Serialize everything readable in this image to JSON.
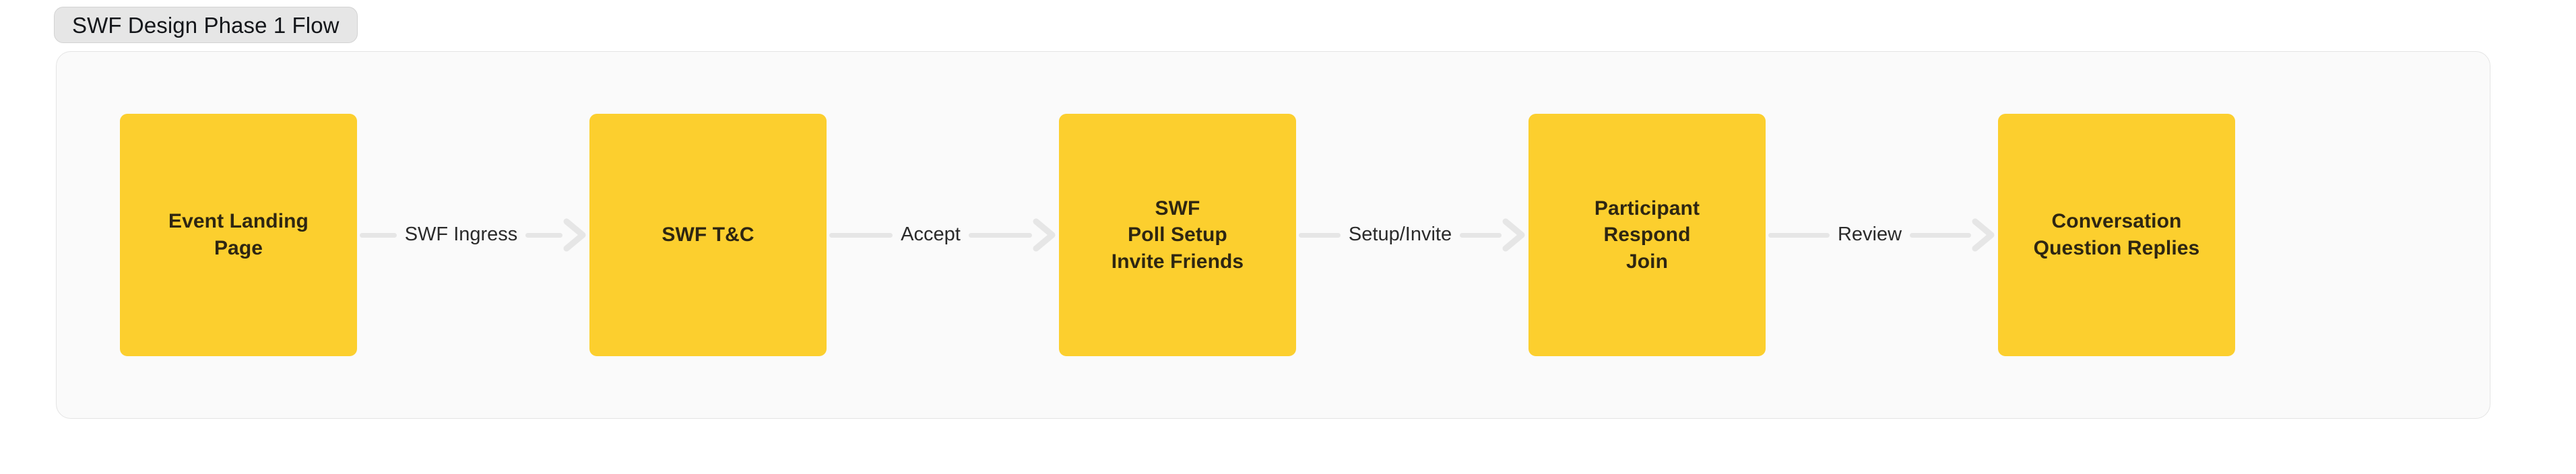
{
  "title_tab": {
    "label": "SWF Design Phase 1 Flow"
  },
  "colors": {
    "node_fill": "#fccf2e",
    "node_text": "#2e2612",
    "canvas": "#fafafa",
    "edge_line": "#e6e6e6",
    "edge_text": "#2b2b2b",
    "tab_fill": "#e6e6e6"
  },
  "diagram": {
    "type": "flowchart",
    "direction": "left-to-right",
    "nodes": [
      {
        "id": "n1",
        "lines": [
          "Event Landing",
          "Page"
        ]
      },
      {
        "id": "n2",
        "lines": [
          "SWF T&C"
        ]
      },
      {
        "id": "n3",
        "lines": [
          "SWF",
          "Poll Setup",
          "Invite Friends"
        ]
      },
      {
        "id": "n4",
        "lines": [
          "Participant",
          "Respond",
          "Join"
        ]
      },
      {
        "id": "n5",
        "lines": [
          "Conversation",
          "Question Replies"
        ]
      }
    ],
    "edges": [
      {
        "id": "e1",
        "from": "n1",
        "to": "n2",
        "label": "SWF Ingress"
      },
      {
        "id": "e2",
        "from": "n2",
        "to": "n3",
        "label": "Accept"
      },
      {
        "id": "e3",
        "from": "n3",
        "to": "n4",
        "label": "Setup/Invite"
      },
      {
        "id": "e4",
        "from": "n4",
        "to": "n5",
        "label": "Review"
      }
    ]
  }
}
